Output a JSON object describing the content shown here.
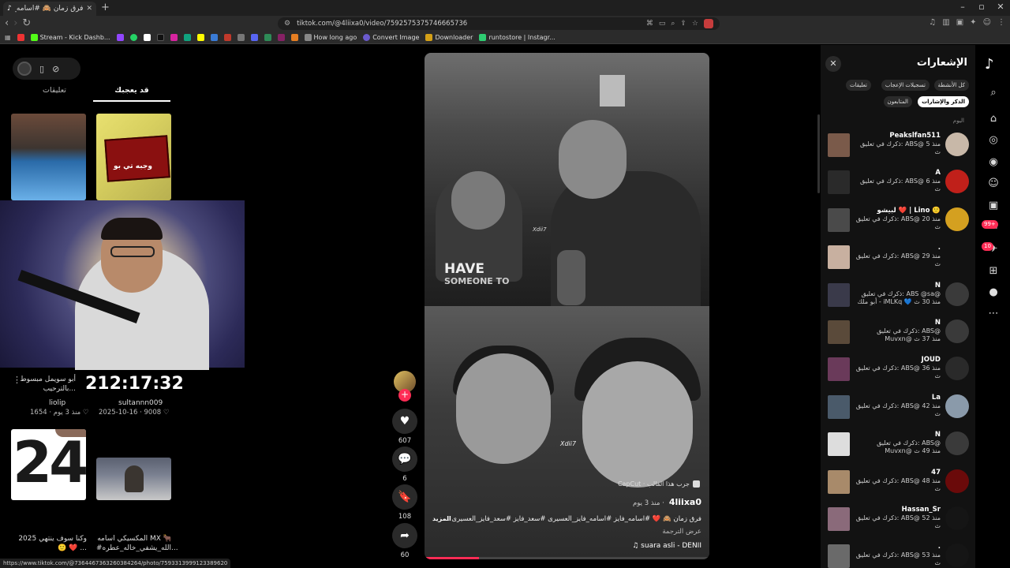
{
  "browser": {
    "tab_title": "فرق زمان 🙈 #اسامه_فايز #",
    "url": "tiktok.com/@4liixa0/video/7592575375746665736",
    "bookmarks": [
      {
        "label": "Stream - Kick Dashb...",
        "color": "#53fc18"
      },
      {
        "label": "How long ago",
        "color": "#888888"
      },
      {
        "label": "Convert Image",
        "color": "#6a5acd"
      },
      {
        "label": "Downloader",
        "color": "#d4a017"
      },
      {
        "label": "runtostore | Instagr...",
        "color": "#2ecc71"
      }
    ],
    "extension_badge": "1"
  },
  "left": {
    "tabs": [
      "تعليقات",
      "قد يعجبك"
    ],
    "clock": "212:17:32",
    "items": [
      {
        "caption": "أبو سويمل مبسوط بالترحيب...",
        "user": "liolip",
        "likes": "1654",
        "date": "منذ 3 يوم"
      },
      {
        "caption": "",
        "user": "sultannn009",
        "likes": "9008",
        "date": "2025-10-16"
      }
    ],
    "thumb_a_caption": "وجبه تي بو",
    "thumb_c_number": "24",
    "bottom_captions": [
      "وكنا سوف ينتهي 2025 🙂 ❤️ ...",
      "المكسيكي اسامه MX 🐂 #الله_يشفي_خاله_عطره..."
    ]
  },
  "video": {
    "overlay_big": "HAVE",
    "overlay_small": "SOMEONE TO",
    "watermark": "Xdii7",
    "template": "CapCut · جرب هذا القالب",
    "author": "4liixa0",
    "posted": "منذ 3 يوم ·",
    "description": "فرق زمان 🙈 ❤️ #اسامه_فايز #اسامه_فايز_العسيرى #سعد_فايز #سعد_فايز_العسيرى ...",
    "more": "المزيد",
    "translate": "عرض الترجمة",
    "music": "♫ suara asli - DENII",
    "progress": 0.19
  },
  "actions": {
    "likes": "607",
    "comments": "6",
    "saves": "108",
    "shares": "60"
  },
  "notifications": {
    "title": "الإشعارات",
    "filters_row1": [
      "كل الأنشطة",
      "تسجيلات الإعجاب",
      "تعليقات"
    ],
    "filters_row2": [
      "الذكر والإشارات",
      "المتابعون"
    ],
    "today": "اليوم",
    "items": [
      {
        "name": "Peakslfan511",
        "msg": "ذكرك في تعليق: ABS@ منذ 5 ث",
        "thumb": "#7a5a4a",
        "ava": "#c8b8a8"
      },
      {
        "name": "A",
        "msg": "ذكرك في تعليق: ABS@ منذ 6 ث",
        "thumb": "#2a2a2a",
        "ava": "#c0201a"
      },
      {
        "name": "لبيشو ❤️ | Lino 🙂",
        "msg": "ذكرك في تعليق: ABS@ منذ 20 ث",
        "thumb": "#4a4a4a",
        "ava": "#d4a020"
      },
      {
        "name": ".",
        "msg": "ذكرك في تعليق: ABS@ منذ 29 ث",
        "thumb": "#c8b0a0",
        "ava": "#121212"
      },
      {
        "name": "N",
        "msg": "ذكرك في تعليق: ABS @sa@ أبو ملك - iMLKq 💙 منذ 30 ث",
        "thumb": "#3a3a4a",
        "ava": "#3a3a3a"
      },
      {
        "name": "N",
        "msg": "ذكرك في تعليق: ABS@ Muvxn@ منذ 37 ث",
        "thumb": "#5a4a3a",
        "ava": "#3a3a3a"
      },
      {
        "name": "JOUD",
        "msg": "ذكرك في تعليق: ABS@ منذ 36 ث",
        "thumb": "#6a3a5a",
        "ava": "#2a2a2a"
      },
      {
        "name": "La",
        "msg": "ذكرك في تعليق: ABS@ منذ 42 ث",
        "thumb": "#4a5a6a",
        "ava": "#8a9aaa"
      },
      {
        "name": "N",
        "msg": "ذكرك في تعليق: ABS@ Muvxn@ منذ 49 ث",
        "thumb": "#dddddd",
        "ava": "#3a3a3a"
      },
      {
        "name": "47",
        "msg": "ذكرك في تعليق: ABS@ منذ 48 ث",
        "thumb": "#a88a6a",
        "ava": "#6a0a0a"
      },
      {
        "name": "Hassan_Sr",
        "msg": "ذكرك في تعليق: ABS@ منذ 52 ث",
        "thumb": "#8a6a7a",
        "ava": "#151515"
      },
      {
        "name": ".",
        "msg": "ذكرك في تعليق: ABS@ منذ 53 ث",
        "thumb": "#6a6a6a",
        "ava": "#151515"
      }
    ]
  },
  "rail": {
    "badge_inbox": "99+",
    "badge_msgs": "10"
  },
  "statusbar": "https://www.tiktok.com/@7364467363260384264/photo/7593313999123389620"
}
